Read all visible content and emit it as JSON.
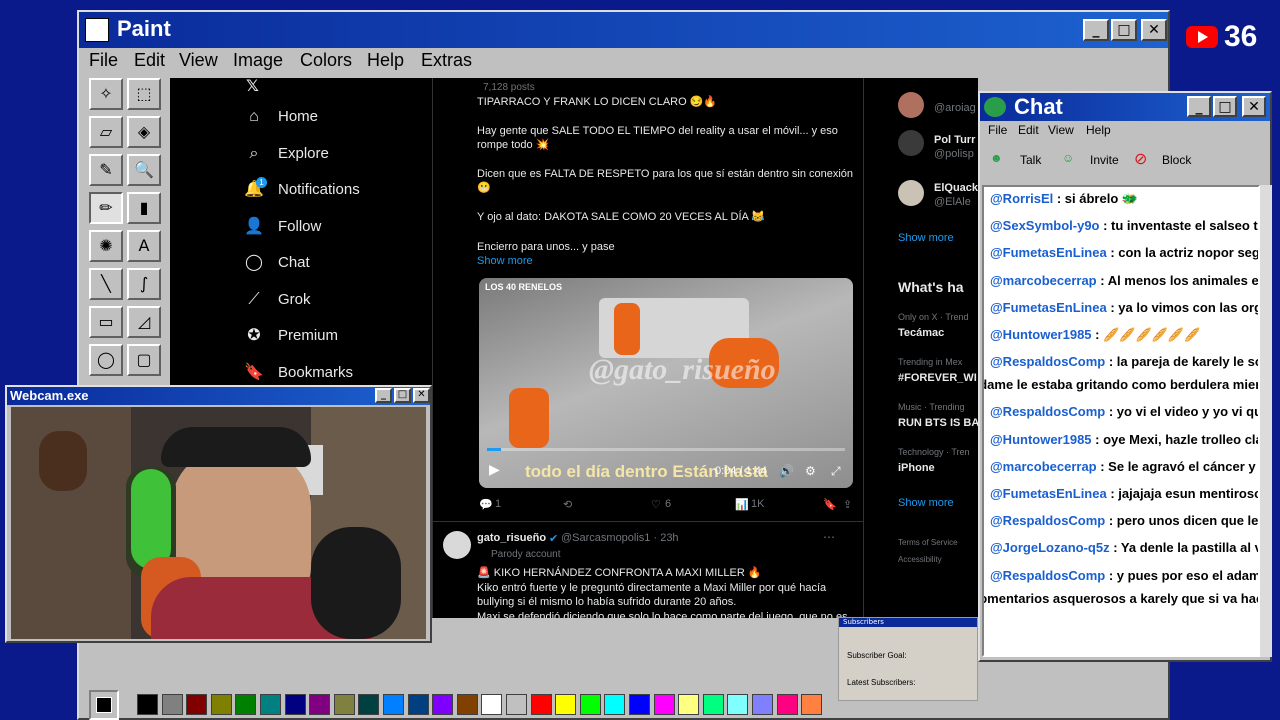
{
  "paint": {
    "title": "Paint",
    "menu": [
      "File",
      "Edit",
      "View",
      "Image",
      "Colors",
      "Help",
      "Extras"
    ],
    "tools": [
      "✧",
      "⬚",
      "▱",
      "◈",
      "✎",
      "🔍",
      "✏",
      "▮",
      "✺",
      "A",
      "╲",
      "∫",
      "▭",
      "◿",
      "◯",
      "▢"
    ],
    "palette": [
      "#000000",
      "#808080",
      "#800000",
      "#808000",
      "#008000",
      "#008080",
      "#000080",
      "#800080",
      "#808040",
      "#004040",
      "#0080ff",
      "#004080",
      "#8000ff",
      "#804000",
      "#ffffff",
      "#c0c0c0",
      "#ff0000",
      "#ffff00",
      "#00ff00",
      "#00ffff",
      "#0000ff",
      "#ff00ff",
      "#ffff80",
      "#00ff80",
      "#80ffff",
      "#8080ff",
      "#ff0080",
      "#ff8040"
    ]
  },
  "twitter": {
    "nav": [
      {
        "icon": "home-icon",
        "glyph": "⌂",
        "label": "Home"
      },
      {
        "icon": "search-icon",
        "glyph": "⌕",
        "label": "Explore"
      },
      {
        "icon": "bell-icon",
        "glyph": "🔔",
        "label": "Notifications"
      },
      {
        "icon": "follow-icon",
        "glyph": "👤",
        "label": "Follow"
      },
      {
        "icon": "chat-icon",
        "glyph": "◯",
        "label": "Chat"
      },
      {
        "icon": "grok-icon",
        "glyph": "⟋",
        "label": "Grok"
      },
      {
        "icon": "premium-icon",
        "glyph": "✪",
        "label": "Premium"
      },
      {
        "icon": "bookmark-icon",
        "glyph": "🔖",
        "label": "Bookmarks"
      }
    ],
    "notif_badge": "1",
    "post1": {
      "posts_count": "7,128 posts",
      "lines": [
        "TIPARRACO Y FRANK LO DICEN CLARO 😏🔥",
        "Hay gente que SALE TODO EL TIEMPO del reality a usar el móvil... y eso rompe todo 💥",
        "Dicen que es FALTA DE RESPETO para los que sí están dentro sin conexión 😬",
        "Y ojo al dato: DAKOTA SALE COMO 20 VECES AL DÍA 😹",
        "Encierro para unos... y pase"
      ],
      "show_more": "Show more",
      "video": {
        "brand": "LOS 40 RENELOS",
        "watermark": "@gato_risueño",
        "caption": "todo el día dentro Están hasta",
        "time": "0:04 / 1:44",
        "progress": 0.04
      },
      "stats": {
        "replies": "1",
        "retweets": "",
        "likes": "6",
        "views": "1K"
      }
    },
    "post2": {
      "name": "gato_risueño",
      "handle": "@Sarcasmopolis1 · 23h",
      "label": "Parody account",
      "lines": [
        "🚨 KIKO HERNÁNDEZ CONFRONTA A MAXI MILLER 🔥",
        "Kiko entró fuerte y le preguntó directamente a Maxi Miller por qué hacía bullying si él mismo lo había sufrido durante 20 años.",
        "Maxi se defendió diciendo que solo lo hace como parte del juego, que no es"
      ]
    },
    "right": {
      "who1": {
        "name": "",
        "handle": "@aroiag"
      },
      "who2": {
        "name": "Pol Turr",
        "handle": "@polisp"
      },
      "who3": {
        "name": "ElQuack",
        "handle": "@ElAle"
      },
      "show_more": "Show more",
      "whats_happening": "What's ha",
      "trends": [
        {
          "meta": "Only on X · Trend",
          "name": "Tecámac"
        },
        {
          "meta": "Trending in Mex",
          "name": "#FOREVER_WI"
        },
        {
          "meta": "Music · Trending",
          "name": "RUN BTS IS BA"
        },
        {
          "meta": "Technology · Tren",
          "name": "iPhone"
        }
      ],
      "show_more2": "Show more",
      "footer1": "Terms of Service",
      "footer2": "Accessibility"
    }
  },
  "webcam": {
    "title": "Webcam.exe"
  },
  "chat": {
    "title": "Chat",
    "menu": [
      "File",
      "Edit",
      "View",
      "Help"
    ],
    "toolbar": [
      "Talk",
      "Invite",
      "Block"
    ],
    "messages": [
      {
        "user": "@RorrisEl",
        "text": ": si ábrelo 🐲"
      },
      {
        "user": "@SexSymbol-y9o",
        "text": ": tu inventaste el salseo tu"
      },
      {
        "user": "@FumetasEnLinea",
        "text": ": con la actriz nopor segu"
      },
      {
        "user": "@marcobecerrap",
        "text": ": Al menos los animales es"
      },
      {
        "user": "@FumetasEnLinea",
        "text": ": ya lo vimos con las orgi"
      },
      {
        "user": "@Huntower1985",
        "text": ": 🥖🥖🥖🥖🥖🥖"
      },
      {
        "user": "@RespaldosComp",
        "text": ": la pareja de karely le so",
        "cont": "adame le estaba gritando como berdulera mient"
      },
      {
        "user": "@RespaldosComp",
        "text": ": yo vi el video y yo vi que"
      },
      {
        "user": "@Huntower1985",
        "text": ": oye Mexi, hazle trolleo cla"
      },
      {
        "user": "@marcobecerrap",
        "text": ": Se le agravó el cáncer y n"
      },
      {
        "user": "@FumetasEnLinea",
        "text": ": jajajaja esun mentiroso"
      },
      {
        "user": "@RespaldosComp",
        "text": ": pero unos dicen que le p"
      },
      {
        "user": "@JorgeLozano-q5z",
        "text": ": Ya denle la pastilla al v"
      },
      {
        "user": "@RespaldosComp",
        "text": ": y pues por eso el adame",
        "cont": "comentarios asquerosos a karely que si va hace"
      }
    ]
  },
  "subs": {
    "title": "Subscribers",
    "goal": "Subscriber Goal:",
    "latest": "Latest Subscribers:"
  },
  "youtube": {
    "count": "36",
    "color": "#ff0000"
  }
}
